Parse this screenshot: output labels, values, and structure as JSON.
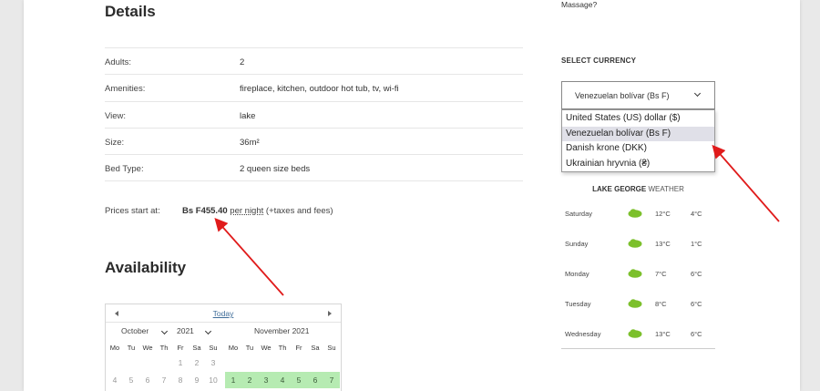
{
  "details": {
    "heading": "Details",
    "rows": [
      {
        "label": "Adults:",
        "value": "2"
      },
      {
        "label": "Amenities:",
        "value": "fireplace, kitchen, outdoor hot tub, tv, wi-fi"
      },
      {
        "label": "View:",
        "value": "lake"
      },
      {
        "label": "Size:",
        "value": "36m²"
      },
      {
        "label": "Bed Type:",
        "value": "2 queen size beds"
      }
    ],
    "price": {
      "label": "Prices start at:",
      "amount": "Bs F455.40",
      "per_night": "per night",
      "suffix": "(+taxes and fees)"
    }
  },
  "availability": {
    "heading": "Availability",
    "today_label": "Today",
    "month1": {
      "month": "October",
      "year": "2021"
    },
    "month2": {
      "label": "November 2021"
    },
    "weekdays": [
      "Mo",
      "Tu",
      "We",
      "Th",
      "Fr",
      "Sa",
      "Su"
    ],
    "oct_row1": [
      "",
      "",
      "",
      "",
      "1",
      "2",
      "3"
    ],
    "oct_row2": [
      "4",
      "5",
      "6",
      "7",
      "8",
      "9",
      "10"
    ],
    "nov_row1": [
      "1",
      "2",
      "3",
      "4",
      "5",
      "6",
      "7"
    ]
  },
  "sidebar": {
    "top_text": "Massage?",
    "currency_label": "SELECT CURRENCY",
    "selected_currency": "Venezuelan bolívar (Bs F)",
    "currency_options": [
      "United States (US) dollar ($)",
      "Venezuelan bolívar (Bs F)",
      "Danish krone (DKK)",
      "Ukrainian hryvnia (₴)"
    ],
    "weather_place": "LAKE GEORGE",
    "weather_word": "WEATHER",
    "weather": [
      {
        "day": "Saturday",
        "hi": "12°C",
        "lo": "4°C"
      },
      {
        "day": "Sunday",
        "hi": "13°C",
        "lo": "1°C"
      },
      {
        "day": "Monday",
        "hi": "7°C",
        "lo": "6°C"
      },
      {
        "day": "Tuesday",
        "hi": "8°C",
        "lo": "6°C"
      },
      {
        "day": "Wednesday",
        "hi": "13°C",
        "lo": "6°C"
      }
    ]
  },
  "colors": {
    "available": "#b6ebb2",
    "arrow": "#e01b1b",
    "weather_icon": "#7cc02c"
  }
}
